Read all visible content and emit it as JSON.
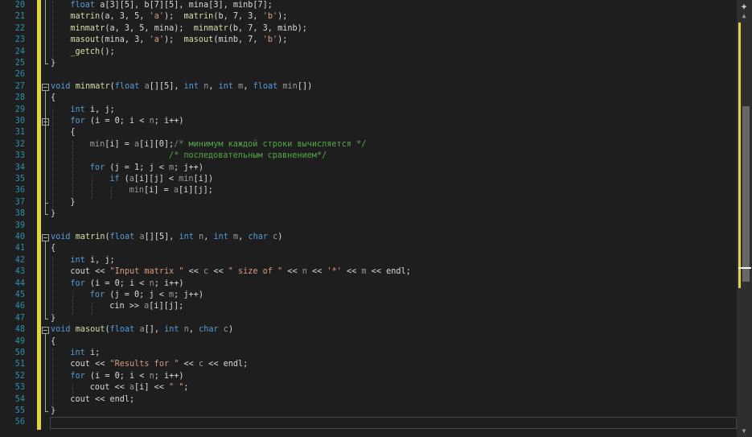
{
  "editor": {
    "lines": [
      {
        "n": "20",
        "fold": null,
        "tokens": [
          [
            "kw",
            "float"
          ],
          [
            "p",
            " "
          ],
          [
            "var",
            "a"
          ],
          [
            "p",
            "[3][5], "
          ],
          [
            "var",
            "b"
          ],
          [
            "p",
            "[7][5], "
          ],
          [
            "var",
            "mina"
          ],
          [
            "p",
            "[3], "
          ],
          [
            "var",
            "minb"
          ],
          [
            "p",
            "[7];"
          ]
        ],
        "indent": 1
      },
      {
        "n": "21",
        "fold": null,
        "tokens": [
          [
            "fn",
            "matrin"
          ],
          [
            "p",
            "("
          ],
          [
            "var",
            "a"
          ],
          [
            "p",
            ", 3, 5, "
          ],
          [
            "str",
            "'a'"
          ],
          [
            "p",
            ");  "
          ],
          [
            "fn",
            "matrin"
          ],
          [
            "p",
            "("
          ],
          [
            "var",
            "b"
          ],
          [
            "p",
            ", 7, 3, "
          ],
          [
            "str",
            "'b'"
          ],
          [
            "p",
            ");"
          ]
        ],
        "indent": 1
      },
      {
        "n": "22",
        "fold": null,
        "tokens": [
          [
            "fn",
            "minmatr"
          ],
          [
            "p",
            "("
          ],
          [
            "var",
            "a"
          ],
          [
            "p",
            ", 3, 5, "
          ],
          [
            "var",
            "mina"
          ],
          [
            "p",
            ");  "
          ],
          [
            "fn",
            "minmatr"
          ],
          [
            "p",
            "("
          ],
          [
            "var",
            "b"
          ],
          [
            "p",
            ", 7, 3, "
          ],
          [
            "var",
            "minb"
          ],
          [
            "p",
            ");"
          ]
        ],
        "indent": 1
      },
      {
        "n": "23",
        "fold": null,
        "tokens": [
          [
            "fn",
            "masout"
          ],
          [
            "p",
            "("
          ],
          [
            "var",
            "mina"
          ],
          [
            "p",
            ", 3, "
          ],
          [
            "str",
            "'a'"
          ],
          [
            "p",
            ");  "
          ],
          [
            "fn",
            "masout"
          ],
          [
            "p",
            "("
          ],
          [
            "var",
            "minb"
          ],
          [
            "p",
            ", 7, "
          ],
          [
            "str",
            "'b'"
          ],
          [
            "p",
            ");"
          ]
        ],
        "indent": 1
      },
      {
        "n": "24",
        "fold": null,
        "tokens": [
          [
            "fn",
            "_getch"
          ],
          [
            "p",
            "();"
          ]
        ],
        "indent": 1
      },
      {
        "n": "25",
        "fold": null,
        "tokens": [
          [
            "p",
            "}"
          ]
        ],
        "indent": 0
      },
      {
        "n": "26",
        "fold": null,
        "tokens": [],
        "indent": 0
      },
      {
        "n": "27",
        "fold": "open",
        "tokens": [
          [
            "kw",
            "void"
          ],
          [
            "p",
            " "
          ],
          [
            "fn",
            "minmatr"
          ],
          [
            "p",
            "("
          ],
          [
            "kw",
            "float"
          ],
          [
            "p",
            " "
          ],
          [
            "param",
            "a"
          ],
          [
            "p",
            "[][5], "
          ],
          [
            "kw",
            "int"
          ],
          [
            "p",
            " "
          ],
          [
            "param",
            "n"
          ],
          [
            "p",
            ", "
          ],
          [
            "kw",
            "int"
          ],
          [
            "p",
            " "
          ],
          [
            "param",
            "m"
          ],
          [
            "p",
            ", "
          ],
          [
            "kw",
            "float"
          ],
          [
            "p",
            " "
          ],
          [
            "param",
            "min"
          ],
          [
            "p",
            "[])"
          ]
        ],
        "indent": 0
      },
      {
        "n": "28",
        "fold": null,
        "tokens": [
          [
            "p",
            "{"
          ]
        ],
        "indent": 0
      },
      {
        "n": "29",
        "fold": null,
        "tokens": [
          [
            "kw",
            "int"
          ],
          [
            "p",
            " "
          ],
          [
            "var",
            "i"
          ],
          [
            "p",
            ", "
          ],
          [
            "var",
            "j"
          ],
          [
            "p",
            ";"
          ]
        ],
        "indent": 1
      },
      {
        "n": "30",
        "fold": "open",
        "tokens": [
          [
            "kw",
            "for"
          ],
          [
            "p",
            " ("
          ],
          [
            "var",
            "i"
          ],
          [
            "p",
            " = 0; "
          ],
          [
            "var",
            "i"
          ],
          [
            "p",
            " < "
          ],
          [
            "param",
            "n"
          ],
          [
            "p",
            "; "
          ],
          [
            "var",
            "i"
          ],
          [
            "p",
            "++)"
          ]
        ],
        "indent": 1
      },
      {
        "n": "31",
        "fold": null,
        "tokens": [
          [
            "p",
            "{"
          ]
        ],
        "indent": 1
      },
      {
        "n": "32",
        "fold": null,
        "tokens": [
          [
            "param",
            "min"
          ],
          [
            "p",
            "["
          ],
          [
            "var",
            "i"
          ],
          [
            "p",
            "] = "
          ],
          [
            "param",
            "a"
          ],
          [
            "p",
            "["
          ],
          [
            "var",
            "i"
          ],
          [
            "p",
            "][0];"
          ],
          [
            "cm",
            "/* минимум каждой строки вычисляется */"
          ]
        ],
        "indent": 2
      },
      {
        "n": "33",
        "fold": null,
        "tokens": [
          [
            "p",
            "                "
          ],
          [
            "cm",
            "/* последовательным сравнением*/"
          ]
        ],
        "indent": 2
      },
      {
        "n": "34",
        "fold": null,
        "tokens": [
          [
            "kw",
            "for"
          ],
          [
            "p",
            " ("
          ],
          [
            "var",
            "j"
          ],
          [
            "p",
            " = 1; "
          ],
          [
            "var",
            "j"
          ],
          [
            "p",
            " < "
          ],
          [
            "param",
            "m"
          ],
          [
            "p",
            "; "
          ],
          [
            "var",
            "j"
          ],
          [
            "p",
            "++)"
          ]
        ],
        "indent": 2
      },
      {
        "n": "35",
        "fold": null,
        "tokens": [
          [
            "kw",
            "if"
          ],
          [
            "p",
            " ("
          ],
          [
            "param",
            "a"
          ],
          [
            "p",
            "["
          ],
          [
            "var",
            "i"
          ],
          [
            "p",
            "]["
          ],
          [
            "var",
            "j"
          ],
          [
            "p",
            "] < "
          ],
          [
            "param",
            "min"
          ],
          [
            "p",
            "["
          ],
          [
            "var",
            "i"
          ],
          [
            "p",
            "])"
          ]
        ],
        "indent": 3
      },
      {
        "n": "36",
        "fold": null,
        "tokens": [
          [
            "param",
            "min"
          ],
          [
            "p",
            "["
          ],
          [
            "var",
            "i"
          ],
          [
            "p",
            "] = "
          ],
          [
            "param",
            "a"
          ],
          [
            "p",
            "["
          ],
          [
            "var",
            "i"
          ],
          [
            "p",
            "]["
          ],
          [
            "var",
            "j"
          ],
          [
            "p",
            "];"
          ]
        ],
        "indent": 4
      },
      {
        "n": "37",
        "fold": null,
        "tokens": [
          [
            "p",
            "}"
          ]
        ],
        "indent": 1
      },
      {
        "n": "38",
        "fold": null,
        "tokens": [
          [
            "p",
            "}"
          ]
        ],
        "indent": 0
      },
      {
        "n": "39",
        "fold": null,
        "tokens": [],
        "indent": 0
      },
      {
        "n": "40",
        "fold": "open",
        "tokens": [
          [
            "kw",
            "void"
          ],
          [
            "p",
            " "
          ],
          [
            "fn",
            "matrin"
          ],
          [
            "p",
            "("
          ],
          [
            "kw",
            "float"
          ],
          [
            "p",
            " "
          ],
          [
            "param",
            "a"
          ],
          [
            "p",
            "[][5], "
          ],
          [
            "kw",
            "int"
          ],
          [
            "p",
            " "
          ],
          [
            "param",
            "n"
          ],
          [
            "p",
            ", "
          ],
          [
            "kw",
            "int"
          ],
          [
            "p",
            " "
          ],
          [
            "param",
            "m"
          ],
          [
            "p",
            ", "
          ],
          [
            "kw",
            "char"
          ],
          [
            "p",
            " "
          ],
          [
            "param",
            "c"
          ],
          [
            "p",
            ")"
          ]
        ],
        "indent": 0
      },
      {
        "n": "41",
        "fold": null,
        "tokens": [
          [
            "p",
            "{"
          ]
        ],
        "indent": 0
      },
      {
        "n": "42",
        "fold": null,
        "tokens": [
          [
            "kw",
            "int"
          ],
          [
            "p",
            " "
          ],
          [
            "var",
            "i"
          ],
          [
            "p",
            ", "
          ],
          [
            "var",
            "j"
          ],
          [
            "p",
            ";"
          ]
        ],
        "indent": 1
      },
      {
        "n": "43",
        "fold": null,
        "tokens": [
          [
            "var",
            "cout"
          ],
          [
            "p",
            " << "
          ],
          [
            "str",
            "\"Input matrix \""
          ],
          [
            "p",
            " << "
          ],
          [
            "param",
            "c"
          ],
          [
            "p",
            " << "
          ],
          [
            "str",
            "\" size of \""
          ],
          [
            "p",
            " << "
          ],
          [
            "param",
            "n"
          ],
          [
            "p",
            " << "
          ],
          [
            "str",
            "'*'"
          ],
          [
            "p",
            " << "
          ],
          [
            "param",
            "m"
          ],
          [
            "p",
            " << "
          ],
          [
            "var",
            "endl"
          ],
          [
            "p",
            ";"
          ]
        ],
        "indent": 1
      },
      {
        "n": "44",
        "fold": null,
        "tokens": [
          [
            "kw",
            "for"
          ],
          [
            "p",
            " ("
          ],
          [
            "var",
            "i"
          ],
          [
            "p",
            " = 0; "
          ],
          [
            "var",
            "i"
          ],
          [
            "p",
            " < "
          ],
          [
            "param",
            "n"
          ],
          [
            "p",
            "; "
          ],
          [
            "var",
            "i"
          ],
          [
            "p",
            "++)"
          ]
        ],
        "indent": 1
      },
      {
        "n": "45",
        "fold": null,
        "tokens": [
          [
            "kw",
            "for"
          ],
          [
            "p",
            " ("
          ],
          [
            "var",
            "j"
          ],
          [
            "p",
            " = 0; "
          ],
          [
            "var",
            "j"
          ],
          [
            "p",
            " < "
          ],
          [
            "param",
            "m"
          ],
          [
            "p",
            "; "
          ],
          [
            "var",
            "j"
          ],
          [
            "p",
            "++)"
          ]
        ],
        "indent": 2
      },
      {
        "n": "46",
        "fold": null,
        "tokens": [
          [
            "var",
            "cin"
          ],
          [
            "p",
            " >> "
          ],
          [
            "param",
            "a"
          ],
          [
            "p",
            "["
          ],
          [
            "var",
            "i"
          ],
          [
            "p",
            "]["
          ],
          [
            "var",
            "j"
          ],
          [
            "p",
            "];"
          ]
        ],
        "indent": 3
      },
      {
        "n": "47",
        "fold": null,
        "tokens": [
          [
            "p",
            "}"
          ]
        ],
        "indent": 0
      },
      {
        "n": "48",
        "fold": "open",
        "tokens": [
          [
            "kw",
            "void"
          ],
          [
            "p",
            " "
          ],
          [
            "fn",
            "masout"
          ],
          [
            "p",
            "("
          ],
          [
            "kw",
            "float"
          ],
          [
            "p",
            " "
          ],
          [
            "param",
            "a"
          ],
          [
            "p",
            "[], "
          ],
          [
            "kw",
            "int"
          ],
          [
            "p",
            " "
          ],
          [
            "param",
            "n"
          ],
          [
            "p",
            ", "
          ],
          [
            "kw",
            "char"
          ],
          [
            "p",
            " "
          ],
          [
            "param",
            "c"
          ],
          [
            "p",
            ")"
          ]
        ],
        "indent": 0
      },
      {
        "n": "49",
        "fold": null,
        "tokens": [
          [
            "p",
            "{"
          ]
        ],
        "indent": 0
      },
      {
        "n": "50",
        "fold": null,
        "tokens": [
          [
            "kw",
            "int"
          ],
          [
            "p",
            " "
          ],
          [
            "var",
            "i"
          ],
          [
            "p",
            ";"
          ]
        ],
        "indent": 1
      },
      {
        "n": "51",
        "fold": null,
        "tokens": [
          [
            "var",
            "cout"
          ],
          [
            "p",
            " << "
          ],
          [
            "str",
            "\"Results for \""
          ],
          [
            "p",
            " << "
          ],
          [
            "param",
            "c"
          ],
          [
            "p",
            " << "
          ],
          [
            "var",
            "endl"
          ],
          [
            "p",
            ";"
          ]
        ],
        "indent": 1
      },
      {
        "n": "52",
        "fold": null,
        "tokens": [
          [
            "kw",
            "for"
          ],
          [
            "p",
            " ("
          ],
          [
            "var",
            "i"
          ],
          [
            "p",
            " = 0; "
          ],
          [
            "var",
            "i"
          ],
          [
            "p",
            " < "
          ],
          [
            "param",
            "n"
          ],
          [
            "p",
            "; "
          ],
          [
            "var",
            "i"
          ],
          [
            "p",
            "++)"
          ]
        ],
        "indent": 1
      },
      {
        "n": "53",
        "fold": null,
        "tokens": [
          [
            "var",
            "cout"
          ],
          [
            "p",
            " << "
          ],
          [
            "param",
            "a"
          ],
          [
            "p",
            "["
          ],
          [
            "var",
            "i"
          ],
          [
            "p",
            "] << "
          ],
          [
            "str",
            "\" \""
          ],
          [
            "p",
            ";"
          ]
        ],
        "indent": 2
      },
      {
        "n": "54",
        "fold": null,
        "tokens": [
          [
            "var",
            "cout"
          ],
          [
            "p",
            " << "
          ],
          [
            "var",
            "endl"
          ],
          [
            "p",
            ";"
          ]
        ],
        "indent": 1
      },
      {
        "n": "55",
        "fold": null,
        "tokens": [
          [
            "p",
            "}"
          ]
        ],
        "indent": 0
      },
      {
        "n": "56",
        "fold": null,
        "tokens": [],
        "indent": 0
      }
    ]
  },
  "scrollbar": {
    "split_icon": "split-icon",
    "up_icon": "arrow-up-icon",
    "down_icon": "arrow-down-icon"
  },
  "colors": {
    "background": "#1e1e1e",
    "line_number": "#2b91af",
    "keyword": "#569cd6",
    "function": "#dcdcaa",
    "string": "#d69d85",
    "comment": "#57a64a",
    "change_marker": "#e2d43e"
  }
}
